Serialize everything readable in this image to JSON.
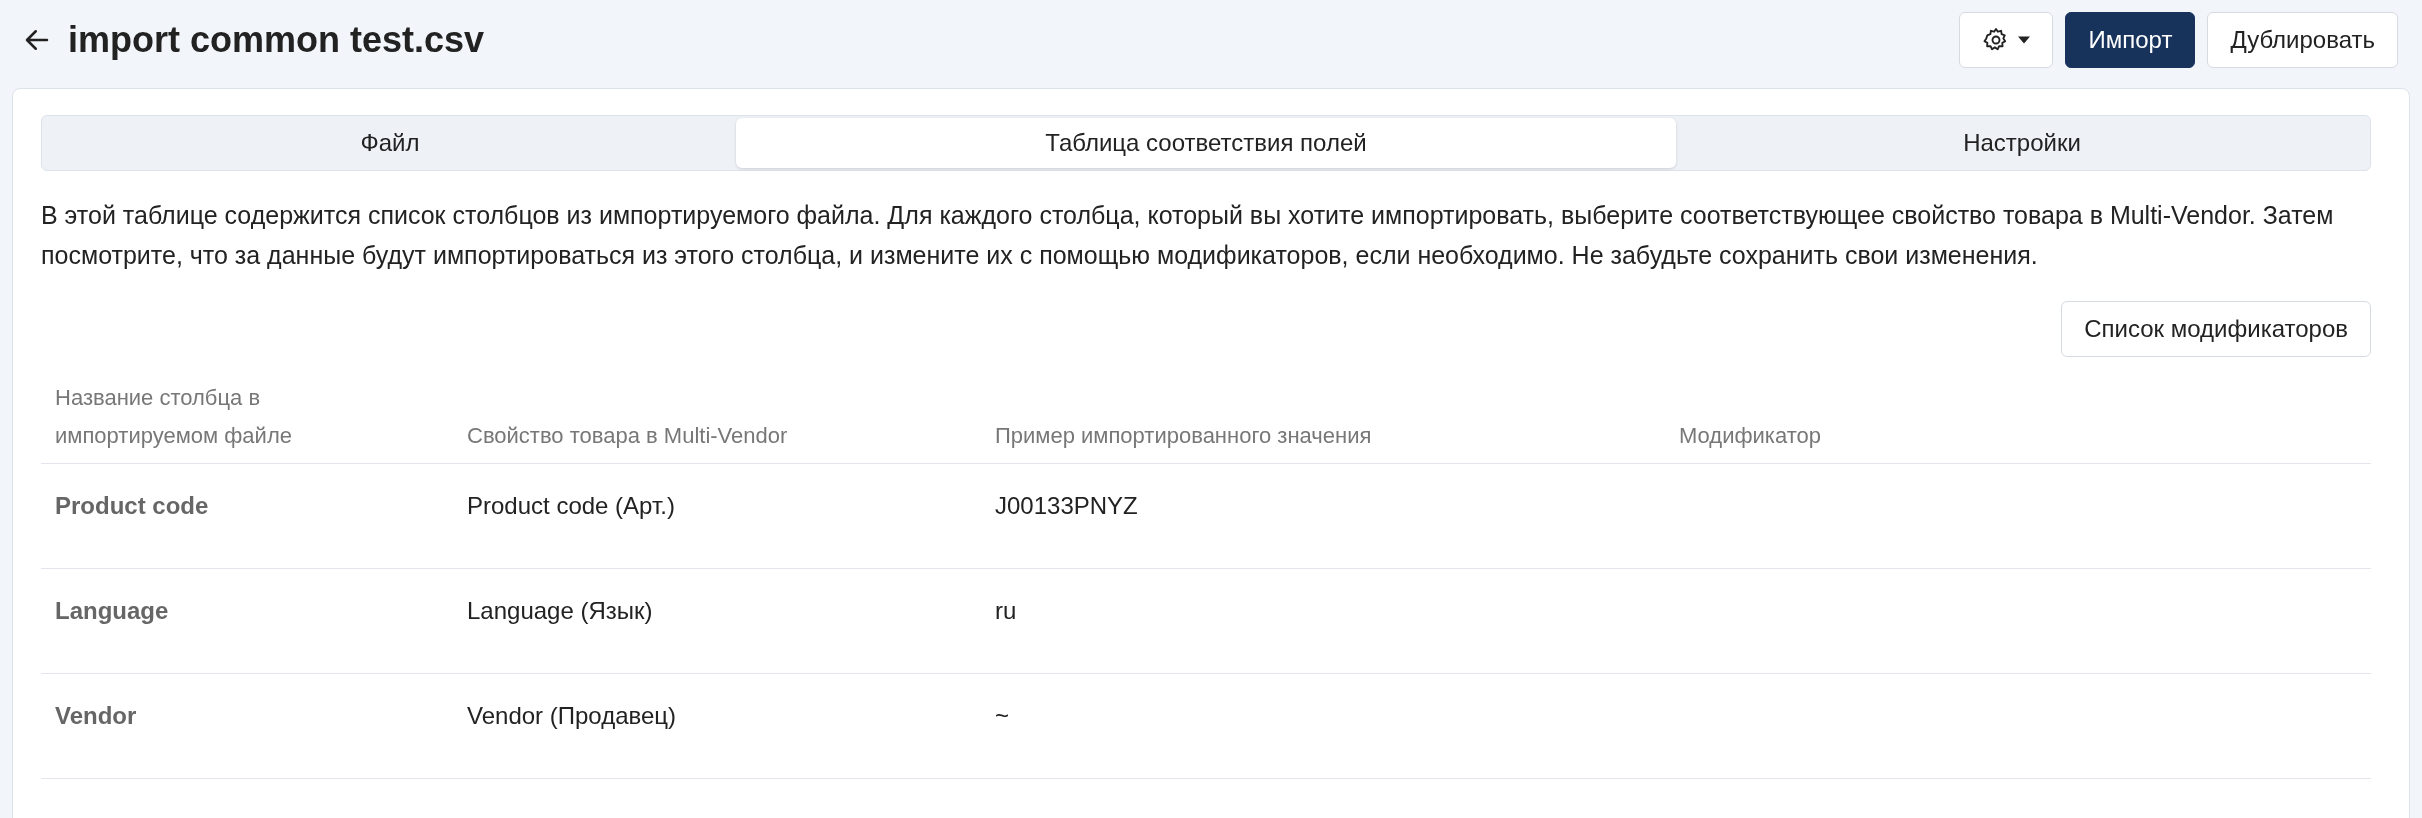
{
  "header": {
    "title": "import common test.csv",
    "buttons": [
      {
        "kind": "settings"
      },
      {
        "kind": "primary",
        "label": "Импорт"
      },
      {
        "kind": "default",
        "label": "Дублировать"
      }
    ]
  },
  "tabs": [
    {
      "label": "Файл",
      "selected": false
    },
    {
      "label": "Таблица соответствия полей",
      "selected": true
    },
    {
      "label": "Настройки",
      "selected": false
    }
  ],
  "description": "В этой таблице содержится список столбцов из импортируемого файла. Для каждого столбца, который вы хотите импортировать, выберите соответствующее свойство товара в Multi-Vendor. Затем посмотрите, что за данные будут импортироваться из этого столбца, и измените их с помощью модификаторов, если необходимо. Не забудьте сохранить свои изменения.",
  "modifiers_button": "Список модификаторов",
  "table": {
    "columns": [
      "Название столбца в импортируемом файле",
      "Свойство товара в Multi-Vendor",
      "Пример импортированного значения",
      "Модификатор"
    ],
    "rows": [
      {
        "column": "Product code",
        "property": "Product code (Арт.)",
        "example": "J00133PNYZ"
      },
      {
        "column": "Language",
        "property": "Language (Язык)",
        "example": "ru"
      },
      {
        "column": "Vendor",
        "property": "Vendor (Продавец)",
        "example": "~"
      }
    ]
  }
}
